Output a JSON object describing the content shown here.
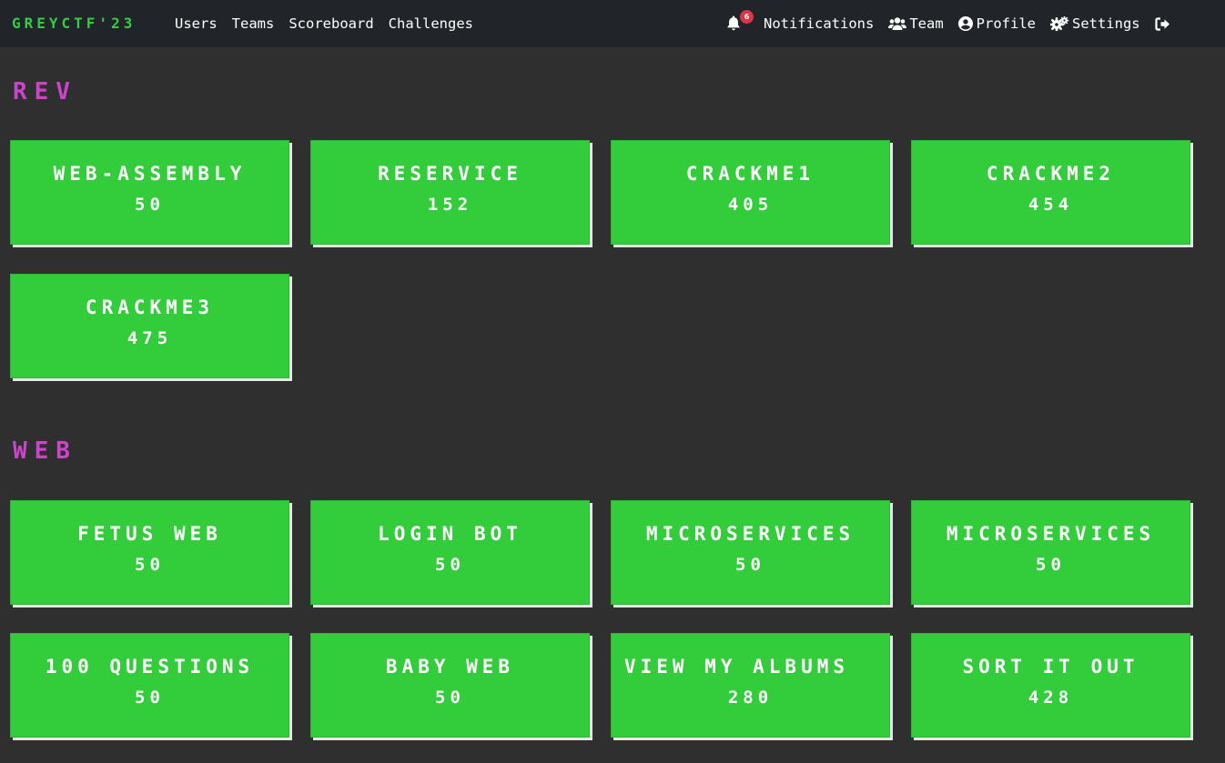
{
  "nav": {
    "brand": "GREYCTF'23",
    "links": [
      "Users",
      "Teams",
      "Scoreboard",
      "Challenges"
    ],
    "notifications_count": "6",
    "notifications_label": "Notifications",
    "team_label": "Team",
    "profile_label": "Profile",
    "settings_label": "Settings"
  },
  "categories": [
    {
      "title": "REV",
      "challenges": [
        {
          "name": "WEB-ASSEMBLY",
          "value": "50"
        },
        {
          "name": "RESERVICE",
          "value": "152"
        },
        {
          "name": "CRACKME1",
          "value": "405"
        },
        {
          "name": "CRACKME2",
          "value": "454"
        },
        {
          "name": "CRACKME3",
          "value": "475"
        }
      ]
    },
    {
      "title": "WEB",
      "challenges": [
        {
          "name": "FETUS WEB",
          "value": "50"
        },
        {
          "name": "LOGIN BOT",
          "value": "50"
        },
        {
          "name": "MICROSERVICES",
          "value": "50"
        },
        {
          "name": "MICROSERVICES",
          "value": "50"
        },
        {
          "name": "100 QUESTIONS",
          "value": "50"
        },
        {
          "name": "BABY WEB",
          "value": "50"
        },
        {
          "name": "VIEW MY ALBUMS",
          "value": "280"
        },
        {
          "name": "SORT IT OUT",
          "value": "428"
        }
      ]
    }
  ],
  "colors": {
    "background": "#2f2f2f",
    "navbar": "#212529",
    "brand": "#33cc44",
    "category_title": "#cc44cc",
    "card": "#33cc3b",
    "badge": "#dc3545"
  }
}
